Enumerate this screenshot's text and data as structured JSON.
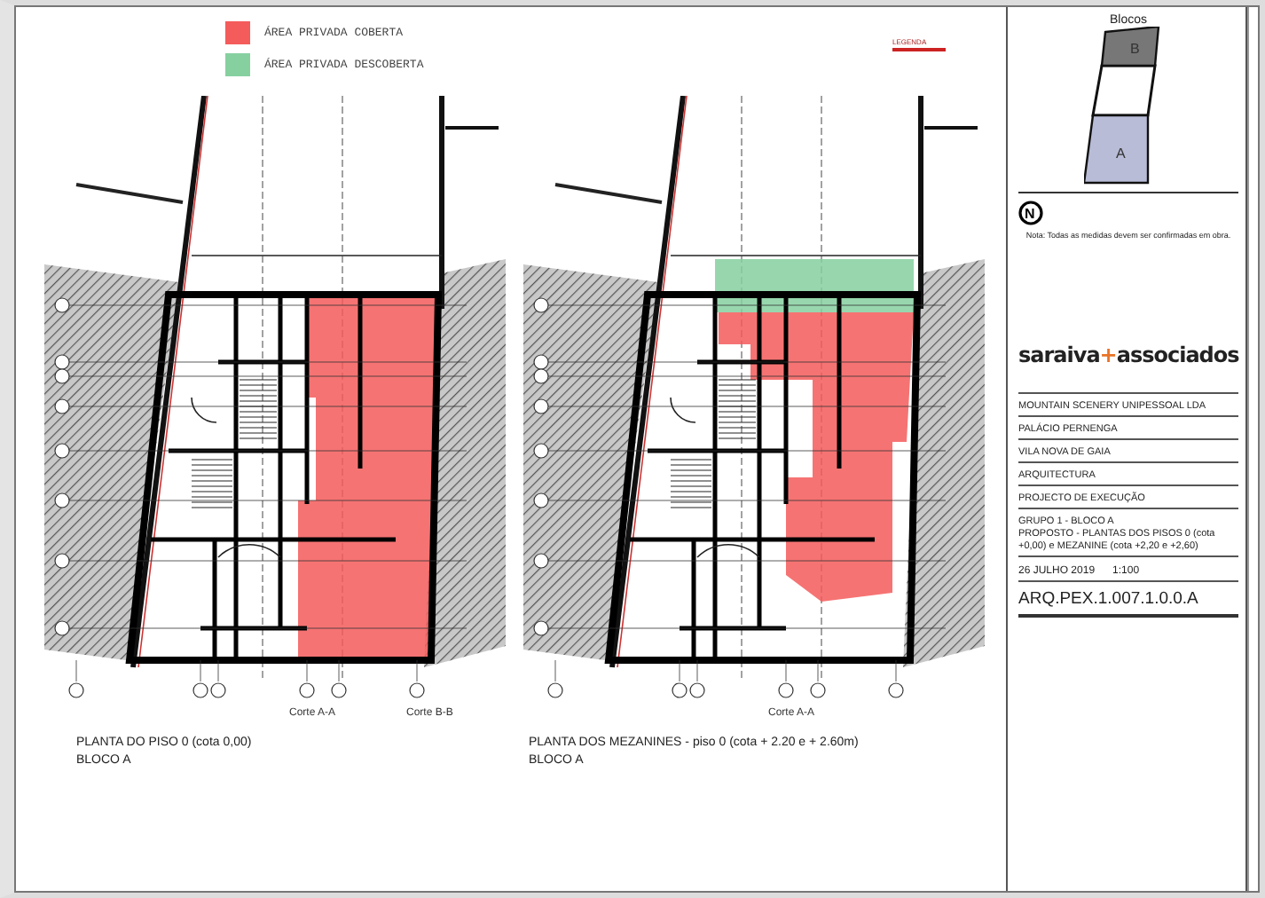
{
  "legend": [
    {
      "label": "ÁREA PRIVADA COBERTA",
      "color": "#f45b5b"
    },
    {
      "label": "ÁREA PRIVADA DESCOBERTA",
      "color": "#86d0a0"
    }
  ],
  "section_legend": {
    "title": "LEGENDA"
  },
  "plans": [
    {
      "kind": "ground",
      "title": "PLANTA DO PISO 0 (cota 0,00)",
      "subtitle": "BLOCO A",
      "cuts": [
        "Corte A-A",
        "Corte B-B"
      ]
    },
    {
      "kind": "mezzanine",
      "title": "PLANTA DOS MEZANINES - piso 0 (cota + 2.20 e + 2.60m)",
      "subtitle": "BLOCO A",
      "cuts": [
        "Corte A-A"
      ]
    }
  ],
  "key_plan": {
    "title": "Blocos",
    "blocks": [
      {
        "label": "B",
        "selected": false
      },
      {
        "label": "A",
        "selected": true
      }
    ]
  },
  "north": "N",
  "note": "Nota: Todas as medidas devem ser confirmadas em obra.",
  "title_block": {
    "logo": {
      "name": "saraiva",
      "plus": "+",
      "partner": "associados"
    },
    "fields": [
      "MOUNTAIN SCENERY UNIPESSOAL LDA",
      "PALÁCIO PERNENGA",
      "VILA NOVA DE GAIA",
      "ARQUITECTURA",
      "PROJECTO DE EXECUÇÃO",
      "GRUPO 1 - BLOCO A\nPROPOSTO - PLANTAS DOS PISOS 0 (cota +0,00) e MEZANINE (cota +2,20 e +2,60)"
    ],
    "date": "26 JULHO 2019",
    "scale": "1:100",
    "drawing_number": "ARQ.PEX.1.007.1.0.0.A"
  }
}
